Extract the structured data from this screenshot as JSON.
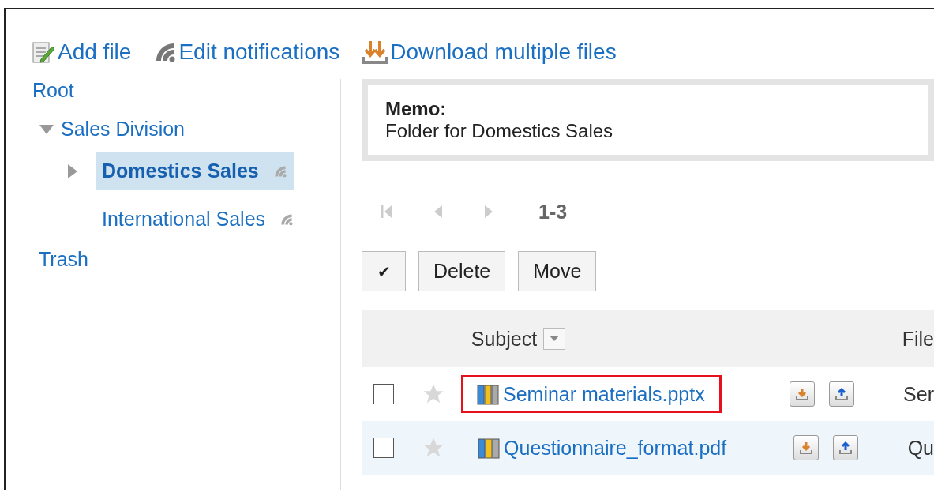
{
  "toolbar": [
    {
      "kind": "add",
      "label": "Add file"
    },
    {
      "kind": "notify",
      "label": "Edit notifications"
    },
    {
      "kind": "download",
      "label": "Download multiple files"
    }
  ],
  "tree": [
    {
      "label": "Root",
      "children": [
        {
          "label": "Sales Division",
          "expanded": true,
          "children": [
            {
              "label": "Domestics Sales",
              "selected": true,
              "expandable": true,
              "subscribed": true
            },
            {
              "label": "International Sales",
              "selected": false,
              "expandable": false,
              "subscribed": true
            }
          ]
        },
        {
          "label": "Trash"
        }
      ]
    }
  ],
  "memo": {
    "label": "Memo:",
    "text": "Folder for Domestics Sales"
  },
  "pager": {
    "range": "1-3"
  },
  "actions": {
    "check_all": "✔",
    "buttons": [
      "Delete",
      "Move"
    ]
  },
  "table": {
    "columns": [
      "Subject",
      "File"
    ],
    "rows": [
      {
        "checked": false,
        "starred": false,
        "subject": "Seminar materials.pptx",
        "highlighted": true,
        "column_3": "Ser"
      },
      {
        "checked": false,
        "starred": false,
        "subject": "Questionnaire_format.pdf",
        "highlighted": false,
        "column_3": "Qu"
      }
    ]
  }
}
